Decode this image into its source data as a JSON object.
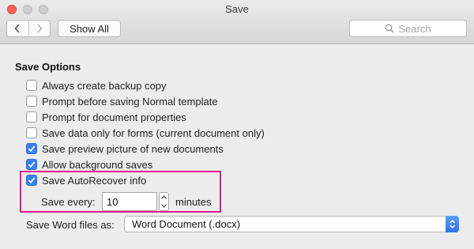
{
  "window": {
    "title": "Save"
  },
  "toolbar": {
    "show_all_label": "Show All",
    "search_placeholder": "Search"
  },
  "section": {
    "title": "Save Options"
  },
  "options": [
    {
      "label": "Always create backup copy",
      "checked": false
    },
    {
      "label": "Prompt before saving Normal template",
      "checked": false
    },
    {
      "label": "Prompt for document properties",
      "checked": false
    },
    {
      "label": "Save data only for forms (current document only)",
      "checked": false
    },
    {
      "label": "Save preview picture of new documents",
      "checked": true
    },
    {
      "label": "Allow background saves",
      "checked": true
    },
    {
      "label": "Save AutoRecover info",
      "checked": true
    }
  ],
  "autorecover": {
    "save_every_label": "Save every:",
    "value": "10",
    "unit_label": "minutes"
  },
  "format": {
    "label": "Save Word files as:",
    "selected": "Word Document (.docx)"
  },
  "colors": {
    "accent": "#3b82f0",
    "highlight": "#e0198e",
    "close": "#fc605c"
  },
  "icons": [
    "close-window-icon",
    "minimize-window-icon",
    "zoom-window-icon",
    "back-chevron-icon",
    "forward-chevron-icon",
    "search-icon",
    "checkmark-icon",
    "stepper-arrows-icon",
    "popup-arrows-icon"
  ]
}
